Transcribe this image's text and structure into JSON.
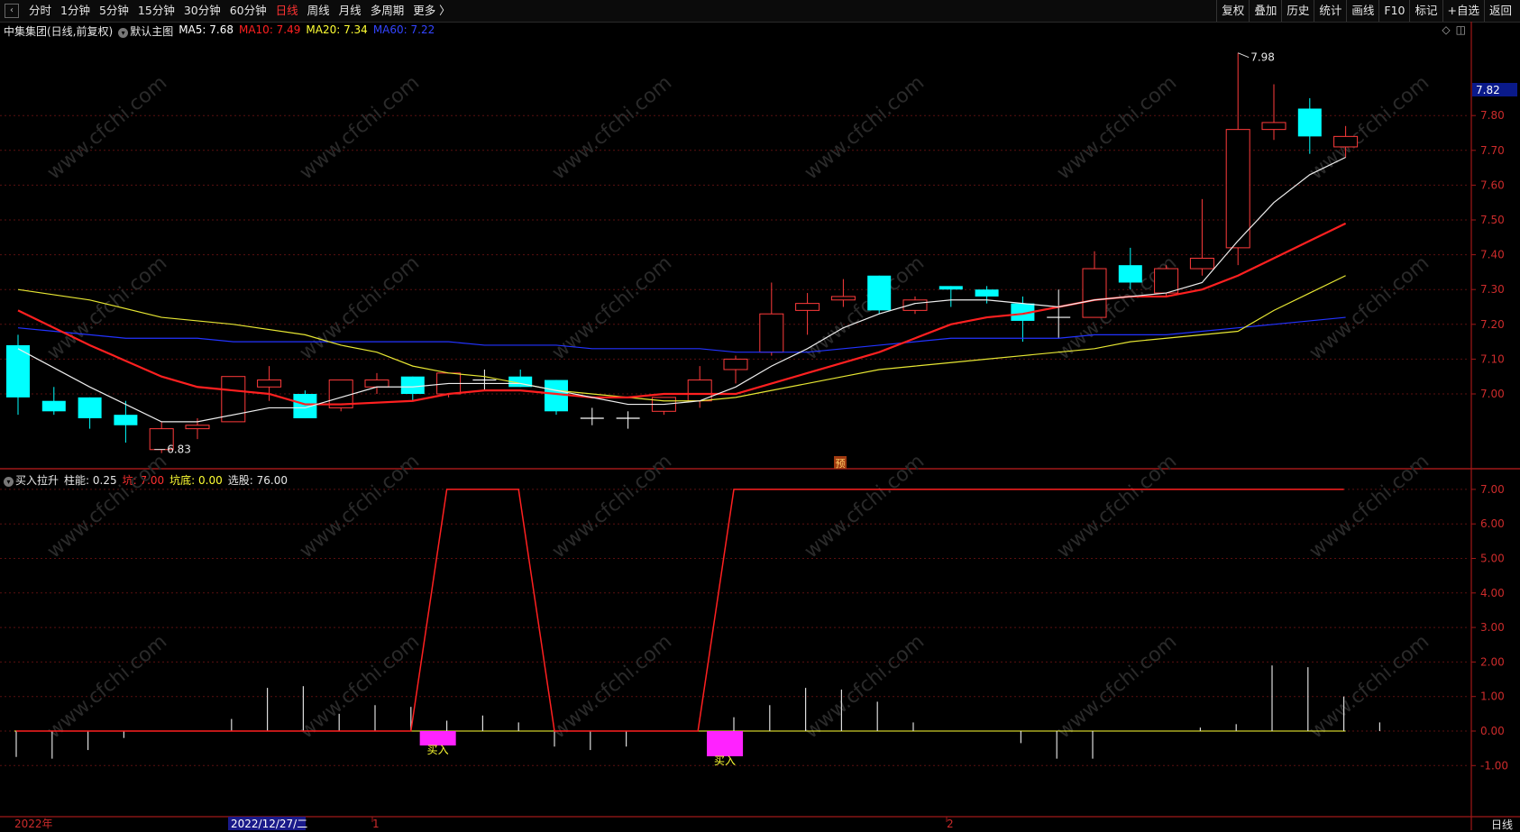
{
  "toolbar": {
    "tabs": [
      "分时",
      "1分钟",
      "5分钟",
      "15分钟",
      "30分钟",
      "60分钟",
      "日线",
      "周线",
      "月线",
      "多周期",
      "更多 〉"
    ],
    "active": "日线",
    "right_tools": [
      "复权",
      "叠加",
      "历史",
      "统计",
      "画线",
      "F10",
      "标记",
      "+自选",
      "返回"
    ]
  },
  "main_panel": {
    "stock_label": "中集集团(日线,前复权)",
    "indicator_name": "默认主图",
    "ma": [
      {
        "label": "MA5: 7.68",
        "color": "#ffffff"
      },
      {
        "label": "MA10: 7.49",
        "color": "#ff2020"
      },
      {
        "label": "MA20: 7.34",
        "color": "#ffff33"
      },
      {
        "label": "MA60: 7.22",
        "color": "#3344ff"
      }
    ],
    "high_label": "7.98",
    "low_label": "6.83",
    "last_price_tag": "7.82",
    "pre_marker": "预"
  },
  "sub_panel": {
    "indicator_name": "买入拉升",
    "fields": [
      {
        "label": "柱能: 0.25",
        "color": "#e6e6e6"
      },
      {
        "label": "坑: 7.00",
        "color": "#ff3030"
      },
      {
        "label": "坑底: 0.00",
        "color": "#ffff33"
      },
      {
        "label": "选股: 76.00",
        "color": "#e6e6e6"
      }
    ],
    "buy_label": "买入"
  },
  "xaxis": {
    "year_label": "2022年",
    "cursor_date": "2022/12/27/二",
    "month_1": "1",
    "month_2": "2",
    "period": "日线"
  },
  "chart_data": {
    "type": "candlestick",
    "price_axis_ticks": [
      "7.80",
      "7.70",
      "7.60",
      "7.50",
      "7.40",
      "7.30",
      "7.20",
      "7.10",
      "7.00"
    ],
    "sub_axis_ticks": [
      "7.00",
      "6.00",
      "5.00",
      "4.00",
      "3.00",
      "2.00",
      "1.00",
      "0.00",
      "-1.00"
    ],
    "candles": [
      {
        "o": 7.14,
        "c": 6.99,
        "h": 7.17,
        "l": 6.94
      },
      {
        "o": 6.98,
        "c": 6.95,
        "h": 7.02,
        "l": 6.94
      },
      {
        "o": 6.99,
        "c": 6.93,
        "h": 6.99,
        "l": 6.9
      },
      {
        "o": 6.94,
        "c": 6.91,
        "h": 6.98,
        "l": 6.86
      },
      {
        "o": 6.84,
        "c": 6.9,
        "h": 6.92,
        "l": 6.83
      },
      {
        "o": 6.9,
        "c": 6.91,
        "h": 6.93,
        "l": 6.87
      },
      {
        "o": 6.92,
        "c": 7.05,
        "h": 7.05,
        "l": 6.92
      },
      {
        "o": 7.02,
        "c": 7.04,
        "h": 7.08,
        "l": 6.98
      },
      {
        "o": 7.0,
        "c": 6.93,
        "h": 7.01,
        "l": 6.93
      },
      {
        "o": 6.96,
        "c": 7.04,
        "h": 7.04,
        "l": 6.95
      },
      {
        "o": 7.02,
        "c": 7.04,
        "h": 7.06,
        "l": 7.0
      },
      {
        "o": 7.05,
        "c": 7.0,
        "h": 7.05,
        "l": 6.98
      },
      {
        "o": 7.0,
        "c": 7.06,
        "h": 7.06,
        "l": 6.99
      },
      {
        "o": 7.04,
        "c": 7.04,
        "h": 7.07,
        "l": 7.01
      },
      {
        "o": 7.05,
        "c": 7.02,
        "h": 7.07,
        "l": 7.02
      },
      {
        "o": 7.04,
        "c": 6.95,
        "h": 7.04,
        "l": 6.94
      },
      {
        "o": 6.93,
        "c": 6.93,
        "h": 6.96,
        "l": 6.91
      },
      {
        "o": 6.93,
        "c": 6.93,
        "h": 6.95,
        "l": 6.9
      },
      {
        "o": 6.95,
        "c": 6.99,
        "h": 6.99,
        "l": 6.94
      },
      {
        "o": 6.98,
        "c": 7.04,
        "h": 7.08,
        "l": 6.96
      },
      {
        "o": 7.07,
        "c": 7.1,
        "h": 7.11,
        "l": 7.03
      },
      {
        "o": 7.12,
        "c": 7.23,
        "h": 7.32,
        "l": 7.11
      },
      {
        "o": 7.24,
        "c": 7.26,
        "h": 7.29,
        "l": 7.17
      },
      {
        "o": 7.27,
        "c": 7.28,
        "h": 7.33,
        "l": 7.25
      },
      {
        "o": 7.34,
        "c": 7.24,
        "h": 7.34,
        "l": 7.23
      },
      {
        "o": 7.24,
        "c": 7.27,
        "h": 7.28,
        "l": 7.23
      },
      {
        "o": 7.31,
        "c": 7.3,
        "h": 7.31,
        "l": 7.25
      },
      {
        "o": 7.3,
        "c": 7.28,
        "h": 7.31,
        "l": 7.26
      },
      {
        "o": 7.26,
        "c": 7.21,
        "h": 7.28,
        "l": 7.15
      },
      {
        "o": 7.22,
        "c": 7.22,
        "h": 7.3,
        "l": 7.16
      },
      {
        "o": 7.22,
        "c": 7.36,
        "h": 7.41,
        "l": 7.22
      },
      {
        "o": 7.37,
        "c": 7.32,
        "h": 7.42,
        "l": 7.3
      },
      {
        "o": 7.29,
        "c": 7.36,
        "h": 7.37,
        "l": 7.28
      },
      {
        "o": 7.36,
        "c": 7.39,
        "h": 7.56,
        "l": 7.34
      },
      {
        "o": 7.42,
        "c": 7.76,
        "h": 7.98,
        "l": 7.37
      },
      {
        "o": 7.76,
        "c": 7.78,
        "h": 7.89,
        "l": 7.73
      },
      {
        "o": 7.82,
        "c": 7.74,
        "h": 7.85,
        "l": 7.69
      },
      {
        "o": 7.71,
        "c": 7.74,
        "h": 7.77,
        "l": 7.68
      }
    ],
    "ma5": [
      7.13,
      null,
      7.02,
      null,
      6.92,
      6.92,
      null,
      6.96,
      6.96,
      6.99,
      7.02,
      7.02,
      7.03,
      7.03,
      7.03,
      7.01,
      6.99,
      6.97,
      6.97,
      6.98,
      7.02,
      7.08,
      7.13,
      7.19,
      7.23,
      7.26,
      7.27,
      7.27,
      7.26,
      7.25,
      7.27,
      7.28,
      7.29,
      7.32,
      7.44,
      7.55,
      7.63,
      7.68
    ],
    "ma10": [
      7.24,
      null,
      7.14,
      null,
      7.05,
      7.02,
      null,
      7.0,
      6.97,
      6.97,
      null,
      6.98,
      7.0,
      7.01,
      7.01,
      7.0,
      6.99,
      6.99,
      7.0,
      7.0,
      7.0,
      7.03,
      7.06,
      7.09,
      7.12,
      7.16,
      7.2,
      7.22,
      7.23,
      7.25,
      7.27,
      7.28,
      7.28,
      7.3,
      7.34,
      7.39,
      7.44,
      7.49
    ],
    "ma20": [
      7.3,
      null,
      7.27,
      null,
      7.22,
      null,
      7.2,
      null,
      7.17,
      7.14,
      7.12,
      7.08,
      7.06,
      7.05,
      7.03,
      7.01,
      7.0,
      6.99,
      6.98,
      6.98,
      6.99,
      7.01,
      7.03,
      7.05,
      7.07,
      7.08,
      7.09,
      7.1,
      7.11,
      7.12,
      7.13,
      7.15,
      7.16,
      7.17,
      7.18,
      7.24,
      7.29,
      7.34
    ],
    "ma60": [
      7.19,
      7.18,
      7.17,
      7.16,
      7.16,
      7.16,
      7.15,
      7.15,
      7.15,
      7.15,
      7.15,
      7.15,
      7.15,
      7.14,
      7.14,
      7.14,
      7.13,
      7.13,
      7.13,
      7.13,
      7.12,
      7.12,
      7.12,
      7.13,
      7.14,
      7.15,
      7.16,
      7.16,
      7.16,
      7.16,
      7.17,
      7.17,
      7.17,
      7.18,
      7.19,
      7.2,
      7.21,
      7.22
    ],
    "kang": [
      0,
      0,
      0,
      0,
      0,
      0,
      0,
      0,
      0,
      0,
      0,
      0,
      7,
      7,
      7,
      0,
      0,
      0,
      0,
      0,
      7,
      7,
      7,
      7,
      7,
      7,
      7,
      7,
      7,
      7,
      7,
      7,
      7,
      7,
      7,
      7,
      7,
      7
    ],
    "bars": [
      -0.75,
      -0.8,
      -0.55,
      -0.2,
      0,
      0,
      0.35,
      1.25,
      1.3,
      0.5,
      0.75,
      0.7,
      0.3,
      0.45,
      0.25,
      -0.45,
      -0.55,
      -0.45,
      0,
      0,
      0.4,
      0.75,
      1.25,
      1.2,
      0.85,
      0.25,
      0,
      0,
      -0.35,
      -0.8,
      -0.8,
      0,
      0,
      0.1,
      0.2,
      1.9,
      1.85,
      1.0,
      0.25
    ],
    "buy_signals": [
      12,
      20
    ]
  }
}
